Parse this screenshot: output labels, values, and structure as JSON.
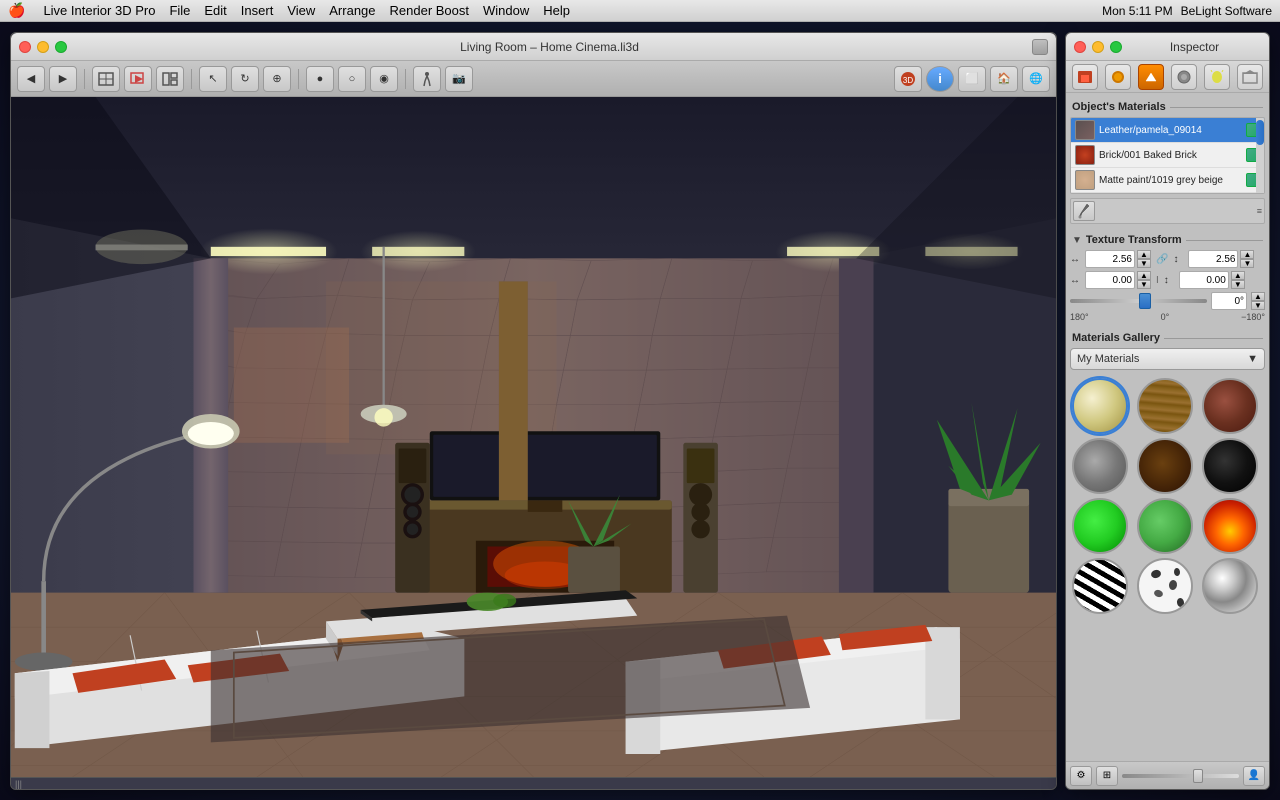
{
  "menubar": {
    "apple": "🍎",
    "items": [
      "Live Interior 3D Pro",
      "File",
      "Edit",
      "Insert",
      "View",
      "Arrange",
      "Render Boost",
      "Window",
      "Help"
    ],
    "right": {
      "time": "Mon 5:11 PM",
      "app": "BeLight Software"
    }
  },
  "window": {
    "title": "Living Room – Home Cinema.li3d",
    "traffic_lights": [
      "close",
      "minimize",
      "maximize"
    ]
  },
  "inspector": {
    "title": "Inspector",
    "tabs": [
      {
        "label": "🏠",
        "icon": "home-icon"
      },
      {
        "label": "⭕",
        "icon": "circle-icon"
      },
      {
        "label": "✏️",
        "icon": "paint-icon",
        "active": true
      },
      {
        "label": "💎",
        "icon": "material-icon"
      },
      {
        "label": "💡",
        "icon": "light-icon"
      },
      {
        "label": "🏠",
        "icon": "room-icon"
      }
    ],
    "objects_materials": {
      "title": "Object's Materials",
      "items": [
        {
          "name": "Leather/pamela_09014",
          "color": "#5a5a5a",
          "selected": true
        },
        {
          "name": "Brick/001 Baked Brick",
          "color": "#c44020"
        },
        {
          "name": "Matte paint/1019 grey beige",
          "color": "#d4b090"
        }
      ]
    },
    "texture_transform": {
      "title": "Texture Transform",
      "width_val": "2.56",
      "height_val": "2.56",
      "offset_x": "0.00",
      "offset_y": "0.00",
      "rotation_val": "0°",
      "rotation_labels": [
        "180°",
        "0°",
        "−180°"
      ]
    },
    "materials_gallery": {
      "title": "Materials Gallery",
      "dropdown": "My Materials",
      "items": [
        {
          "type": "plain",
          "color": "#e8d890",
          "selected": true
        },
        {
          "type": "wood",
          "color": "#8B6520"
        },
        {
          "type": "brick",
          "color": "#7a4530"
        },
        {
          "type": "concrete",
          "color": "#888888"
        },
        {
          "type": "wood-dark",
          "color": "#5a3810"
        },
        {
          "type": "dark",
          "color": "#1a1a1a"
        },
        {
          "type": "green-bright",
          "color": "#22cc22"
        },
        {
          "type": "green-mid",
          "color": "#44aa44"
        },
        {
          "type": "fire",
          "color": "#cc4400"
        },
        {
          "type": "zebra",
          "color": "#f0f0f0"
        },
        {
          "type": "dalmatian",
          "color": "#f0f0f0"
        },
        {
          "type": "chrome",
          "color": "#c0c0c0"
        }
      ]
    }
  }
}
